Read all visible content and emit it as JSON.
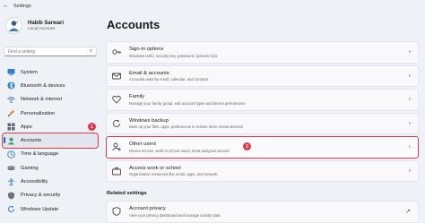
{
  "window": {
    "title": "Settings"
  },
  "profile": {
    "name": "Habib Sarwari",
    "account_type": "Local Account"
  },
  "search": {
    "placeholder": "Find a setting"
  },
  "sidebar": {
    "items": [
      {
        "label": "System",
        "icon": "monitor-icon",
        "color": "#2f7fd6"
      },
      {
        "label": "Bluetooth & devices",
        "icon": "bluetooth-icon",
        "color": "#2f7fd6"
      },
      {
        "label": "Network & internet",
        "icon": "wifi-icon",
        "color": "#4a6fa5"
      },
      {
        "label": "Personalization",
        "icon": "brush-icon",
        "color": "#d08a2b"
      },
      {
        "label": "Apps",
        "icon": "apps-icon",
        "color": "#5a6577"
      },
      {
        "label": "Accounts",
        "icon": "person-icon",
        "color": "#2fa36b",
        "active": true
      },
      {
        "label": "Time & language",
        "icon": "globe-clock-icon",
        "color": "#2f7fd6"
      },
      {
        "label": "Gaming",
        "icon": "controller-icon",
        "color": "#6b7280"
      },
      {
        "label": "Accessibility",
        "icon": "accessibility-icon",
        "color": "#2f7fd6"
      },
      {
        "label": "Privacy & security",
        "icon": "shield-icon",
        "color": "#6b7280"
      },
      {
        "label": "Windows Update",
        "icon": "update-icon",
        "color": "#2f7fd6"
      }
    ]
  },
  "main": {
    "title": "Accounts",
    "cards": [
      {
        "title": "Sign-in options",
        "desc": "Windows Hello, security key, password, dynamic lock",
        "icon": "key-icon"
      },
      {
        "title": "Email & accounts",
        "desc": "Accounts used by email, calendar, and contacts",
        "icon": "mail-icon"
      },
      {
        "title": "Family",
        "desc": "Manage your family group, edit account types and device permissions",
        "icon": "heart-icon"
      },
      {
        "title": "Windows backup",
        "desc": "Back up your files, apps, preferences to restore them across devices",
        "icon": "refresh-icon"
      },
      {
        "title": "Other users",
        "desc": "Device access, work or school users, kiosk assigned access",
        "icon": "person-add-icon",
        "highlight": true
      },
      {
        "title": "Access work or school",
        "desc": "Organization resources like email, apps, and network",
        "icon": "briefcase-icon"
      }
    ],
    "related_heading": "Related settings",
    "related": {
      "title": "Account privacy",
      "desc": "View your privacy dashboard and manage activity data",
      "icon": "shield-icon"
    }
  },
  "annotations": {
    "badge_sidebar": "1",
    "badge_card": "2"
  },
  "colors": {
    "accent": "#0067c0",
    "highlight": "#e0394a",
    "background": "#eef1f6"
  }
}
